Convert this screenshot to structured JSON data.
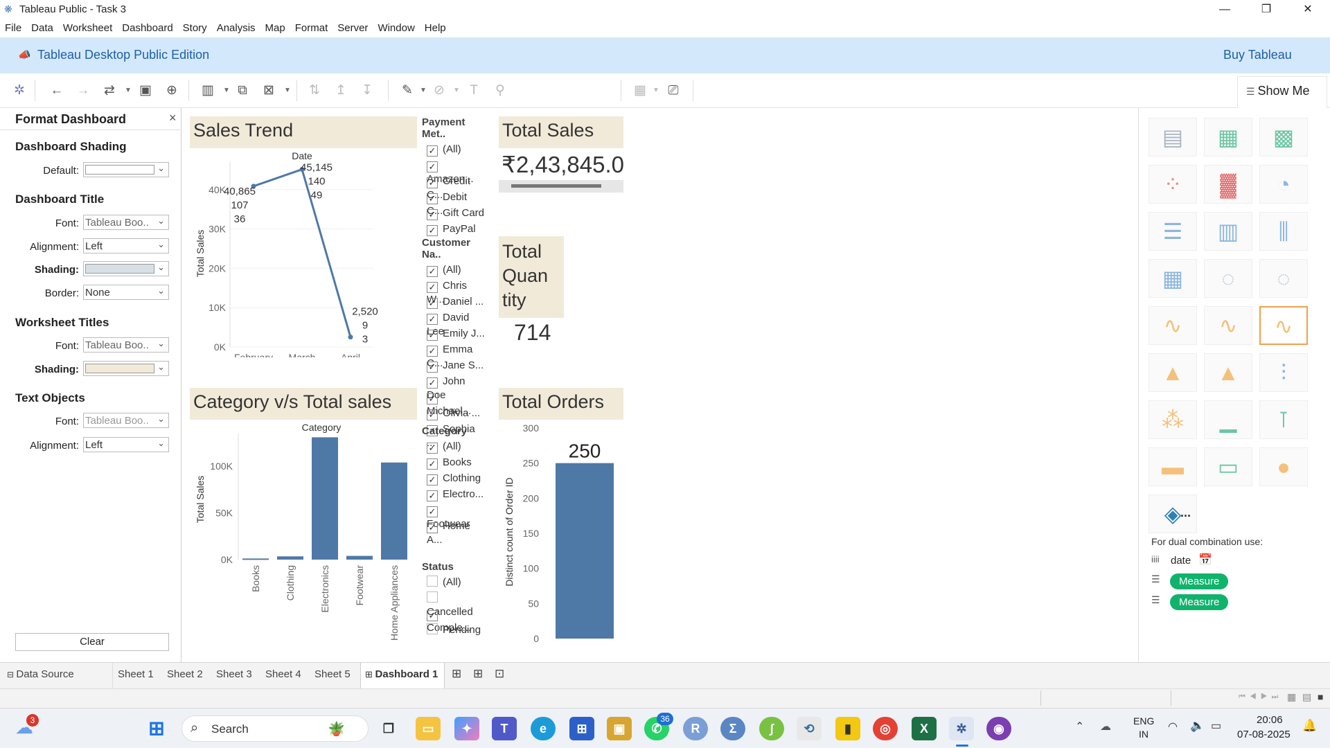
{
  "window": {
    "title": "Tableau Public - Task 3",
    "minimize": "—",
    "restore": "❐",
    "close": "✕"
  },
  "menu": [
    "File",
    "Data",
    "Worksheet",
    "Dashboard",
    "Story",
    "Analysis",
    "Map",
    "Format",
    "Server",
    "Window",
    "Help"
  ],
  "banner": {
    "edition": "Tableau Desktop Public Edition",
    "buy": "Buy Tableau"
  },
  "showme": {
    "label": "Show Me"
  },
  "format_pane": {
    "title": "Format Dashboard",
    "close": "×",
    "shading_section": "Dashboard Shading",
    "default_label": "Default:",
    "title_section": "Dashboard Title",
    "font_label": "Font:",
    "font_value": "Tableau Boo..",
    "alignment_label": "Alignment:",
    "alignment_value": "Left",
    "shading_label": "Shading:",
    "border_label": "Border:",
    "border_value": "None",
    "worksheet_titles_section": "Worksheet Titles",
    "text_objects_section": "Text Objects",
    "clear_label": "Clear",
    "colors": {
      "title_shading": "#d6e0e6",
      "worksheet_shading": "#f2ead9"
    }
  },
  "sales_trend": {
    "header": "Sales Trend",
    "xlabel": "Date",
    "ylabel": "Total Sales",
    "yticks": [
      "40K",
      "30K",
      "20K",
      "10K",
      "0K"
    ],
    "chart_data": {
      "type": "line",
      "categories": [
        "February",
        "March",
        "April"
      ],
      "values": [
        40865,
        45145,
        2520
      ],
      "labels": [
        [
          "40,865",
          "107",
          "36"
        ],
        [
          "45,145",
          "140",
          "49"
        ],
        [
          "2,520",
          "9",
          "3"
        ]
      ],
      "ylim": [
        0,
        47000
      ],
      "color": "#4e79a7"
    }
  },
  "category_sales": {
    "header": "Category v/s Total sales",
    "xlabel": "Category",
    "ylabel": "Total Sales",
    "yticks": [
      "100K",
      "50K",
      "0K"
    ],
    "chart_data": {
      "type": "bar",
      "categories": [
        "Books",
        "Clothing",
        "Electronics",
        "Footwear",
        "Home Appliances"
      ],
      "values": [
        1200,
        3500,
        131000,
        4000,
        104000
      ],
      "ylim": [
        0,
        135000
      ],
      "color": "#4e79a7"
    }
  },
  "filters": [
    {
      "title": "Payment Met..",
      "items": [
        {
          "label": "(All)",
          "checked": true
        },
        {
          "label": "Amazon...",
          "checked": true
        },
        {
          "label": "Credit C...",
          "checked": true
        },
        {
          "label": "Debit C...",
          "checked": true
        },
        {
          "label": "Gift Card",
          "checked": true
        },
        {
          "label": "PayPal",
          "checked": true
        }
      ]
    },
    {
      "title": "Customer Na..",
      "items": [
        {
          "label": "(All)",
          "checked": true
        },
        {
          "label": "Chris W...",
          "checked": true
        },
        {
          "label": "Daniel ...",
          "checked": true
        },
        {
          "label": "David Lee",
          "checked": true
        },
        {
          "label": "Emily J...",
          "checked": true
        },
        {
          "label": "Emma C...",
          "checked": true
        },
        {
          "label": "Jane S...",
          "checked": true
        },
        {
          "label": "John Doe",
          "checked": true
        },
        {
          "label": "Michael...",
          "checked": true
        },
        {
          "label": "Olivia ...",
          "checked": true
        },
        {
          "label": "Sophia ...",
          "checked": true
        }
      ]
    },
    {
      "title": "Category",
      "items": [
        {
          "label": "(All)",
          "checked": true
        },
        {
          "label": "Books",
          "checked": true
        },
        {
          "label": "Clothing",
          "checked": true
        },
        {
          "label": "Electro...",
          "checked": true
        },
        {
          "label": "Footwear",
          "checked": true
        },
        {
          "label": "Home A...",
          "checked": true
        }
      ]
    },
    {
      "title": "Status",
      "items": [
        {
          "label": "(All)",
          "checked": false
        },
        {
          "label": "Cancelled",
          "checked": false
        },
        {
          "label": "Comple...",
          "checked": true
        },
        {
          "label": "Pending",
          "checked": false
        }
      ]
    }
  ],
  "total_sales": {
    "header": "Total Sales",
    "value": "₹2,43,845.0"
  },
  "total_quantity": {
    "header_lines": [
      "Total",
      "Quan",
      "tity"
    ],
    "value": "714"
  },
  "total_orders": {
    "header": "Total Orders",
    "ylabel": "Distinct count of Order ID",
    "yticks": [
      "300",
      "250",
      "200",
      "150",
      "100",
      "50",
      "0"
    ],
    "chart_data": {
      "type": "bar",
      "categories": [
        ""
      ],
      "values": [
        250
      ],
      "label": "250",
      "ylim": [
        0,
        300
      ],
      "color": "#4e79a7"
    }
  },
  "showme_panel": {
    "dual_label": "For dual combination use:",
    "date_field": "date",
    "measure1": "Measure",
    "measure2": "Measure",
    "more": "..."
  },
  "sheet_tabs": [
    "Data Source",
    "Sheet 1",
    "Sheet 2",
    "Sheet 3",
    "Sheet 4",
    "Sheet 5",
    "Dashboard 1"
  ],
  "taskbar": {
    "search": "Search",
    "weather_badge": "3",
    "whatsapp_badge": "36",
    "lang1": "ENG",
    "lang2": "IN",
    "time": "20:06",
    "date": "07-08-2025"
  }
}
